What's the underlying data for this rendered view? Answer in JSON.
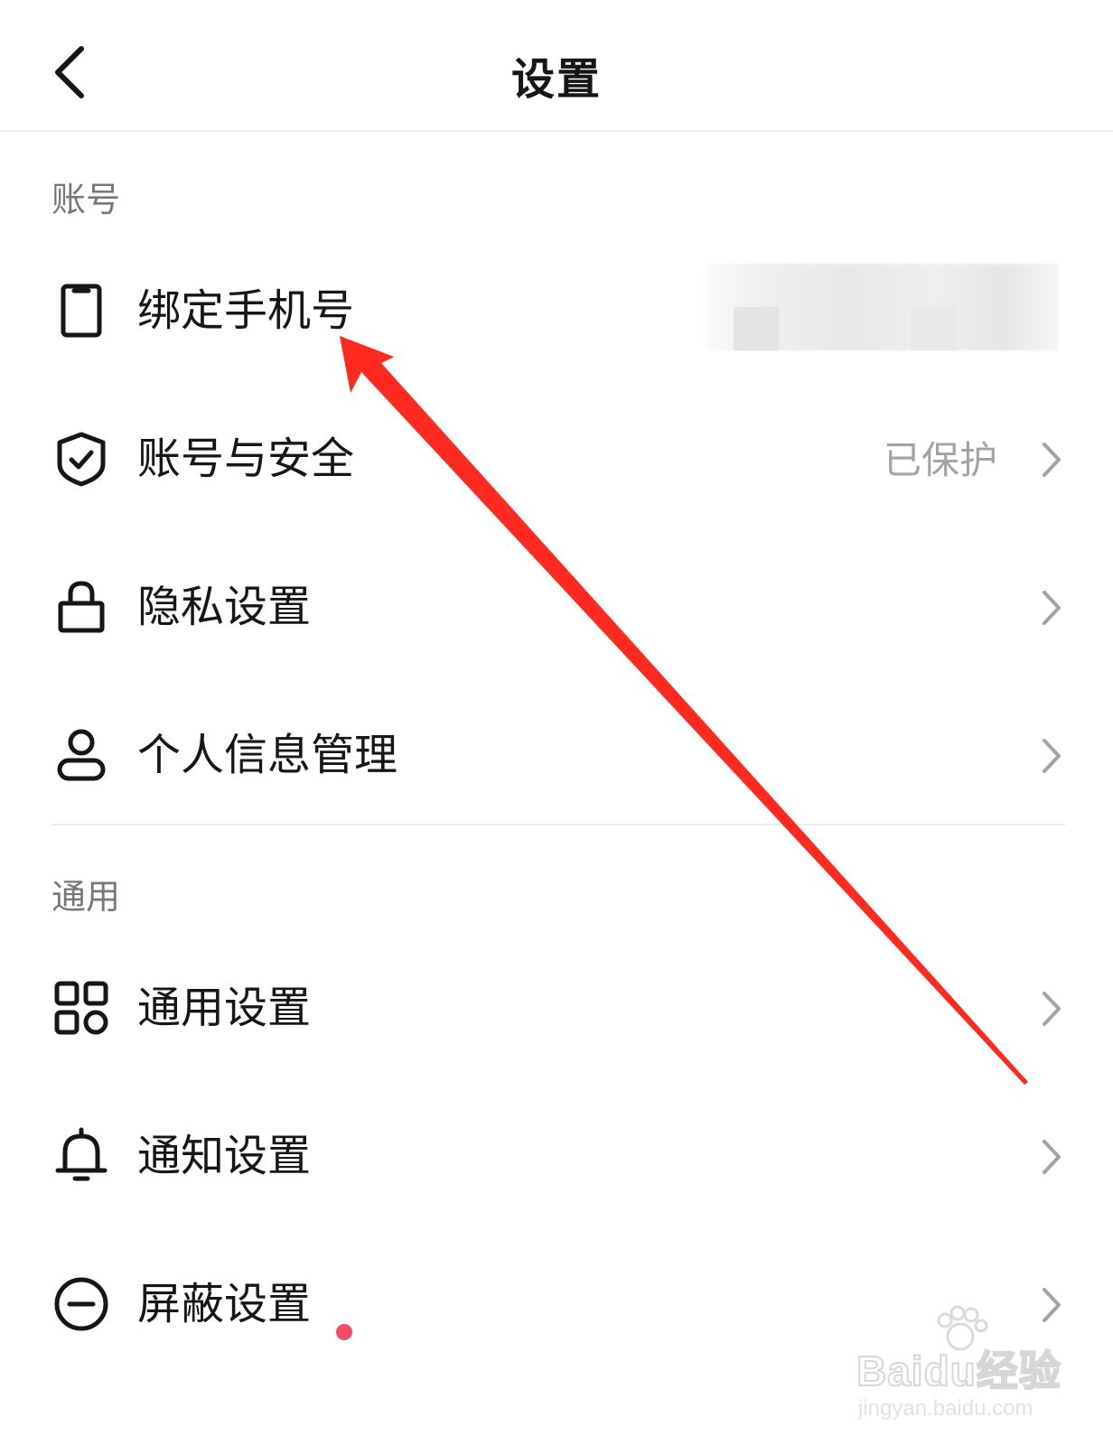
{
  "header": {
    "title": "设置"
  },
  "sections": [
    {
      "title": "账号",
      "items": [
        {
          "label": "绑定手机号",
          "icon": "phone-icon",
          "value": ""
        },
        {
          "label": "账号与安全",
          "icon": "shield-check-icon",
          "value": "已保护"
        },
        {
          "label": "隐私设置",
          "icon": "lock-icon",
          "value": ""
        },
        {
          "label": "个人信息管理",
          "icon": "person-icon",
          "value": ""
        }
      ]
    },
    {
      "title": "通用",
      "items": [
        {
          "label": "通用设置",
          "icon": "grid-icon",
          "value": ""
        },
        {
          "label": "通知设置",
          "icon": "bell-icon",
          "value": ""
        },
        {
          "label": "屏蔽设置",
          "icon": "minus-circle-icon",
          "value": "",
          "badge": "red-dot"
        }
      ]
    }
  ],
  "annotation": {
    "color": "#ff2a1f"
  },
  "watermark": {
    "brand": "Baidu经验",
    "url": "jingyan.baidu.com"
  }
}
